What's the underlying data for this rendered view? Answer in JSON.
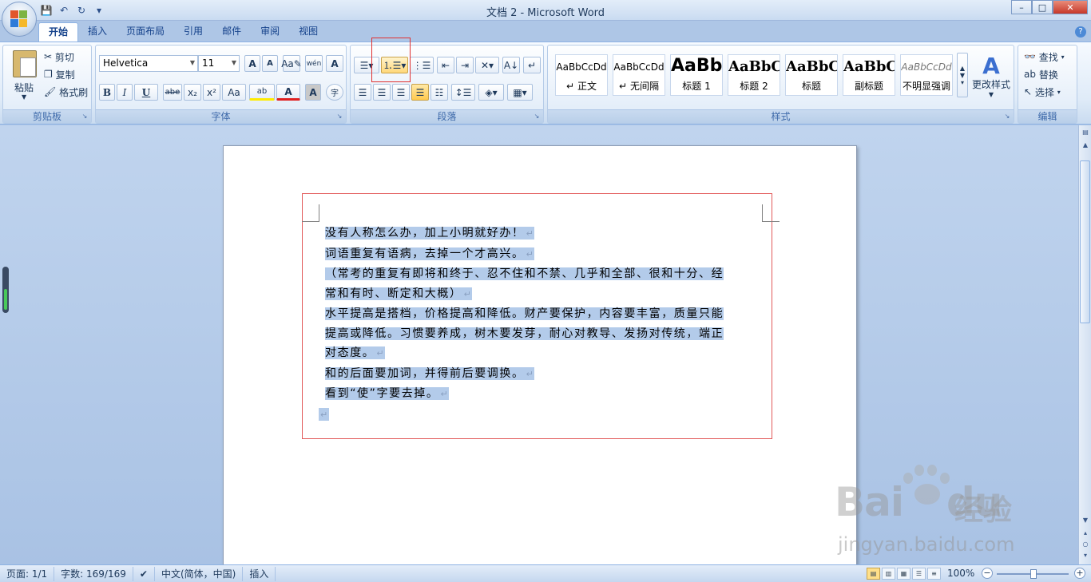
{
  "window": {
    "title": "文档 2 - Microsoft Word",
    "controls": {
      "minimize": "–",
      "maximize": "□",
      "close": "✕"
    }
  },
  "qat": {
    "save_icon": "💾",
    "undo_icon": "↶",
    "redo_icon": "↻",
    "more_icon": "▾"
  },
  "tabs": [
    {
      "label": "开始",
      "active": true
    },
    {
      "label": "插入"
    },
    {
      "label": "页面布局"
    },
    {
      "label": "引用"
    },
    {
      "label": "邮件"
    },
    {
      "label": "审阅"
    },
    {
      "label": "视图"
    }
  ],
  "ribbon": {
    "clipboard": {
      "label": "剪贴板",
      "paste": "粘贴",
      "cut": "剪切",
      "copy": "复制",
      "format_painter": "格式刷"
    },
    "font": {
      "label": "字体",
      "family": "Helvetica",
      "size": "11",
      "grow": "A",
      "shrink": "A",
      "bold": "B",
      "italic": "I",
      "underline": "U",
      "strike": "abe",
      "subscript": "x₂",
      "superscript": "x²",
      "case": "Aa",
      "highlight": "ab",
      "font_color": "A",
      "char_shade": "A",
      "enclose": "字",
      "phonetic": "wén",
      "border": "A"
    },
    "paragraph": {
      "label": "段落"
    },
    "styles": {
      "label": "样式",
      "items": [
        {
          "sample": "AaBbCcDd",
          "name": "正文",
          "mark": "↵"
        },
        {
          "sample": "AaBbCcDd",
          "name": "无间隔",
          "mark": "↵"
        },
        {
          "sample": "AaBb",
          "name": "标题 1"
        },
        {
          "sample": "AaBbC",
          "name": "标题 2"
        },
        {
          "sample": "AaBbC",
          "name": "标题"
        },
        {
          "sample": "AaBbC",
          "name": "副标题"
        },
        {
          "sample": "AaBbCcDd",
          "name": "不明显强调"
        }
      ],
      "change_styles": "更改样式"
    },
    "editing": {
      "label": "编辑",
      "find": "查找",
      "replace": "替换",
      "select": "选择"
    }
  },
  "document": {
    "lines": [
      "没有人称怎么办，加上小明就好办！",
      "词语重复有语病，去掉一个才高兴。",
      "（常考的重复有即将和终于、忍不住和不禁、几乎和全部、很和十分、经",
      "常和有时、断定和大概）",
      "水平提高是搭档，价格提高和降低。财产要保护，内容要丰富，质量只能",
      "提高或降低。习惯要养成，树木要发芽，耐心对教导、发扬对传统，端正",
      "对态度。",
      "和的后面要加词，并得前后要调换。",
      "看到“使”字要去掉。",
      ""
    ],
    "para_end_lines": [
      0,
      1,
      3,
      6,
      7,
      8,
      9
    ],
    "para_mark": "↵"
  },
  "statusbar": {
    "page": "页面: 1/1",
    "words": "字数: 169/169",
    "language": "中文(简体，中国)",
    "mode": "插入",
    "zoom": "100%"
  },
  "watermark": {
    "brand": "Bai",
    "brand2": "du",
    "cn": "经验",
    "url": "jingyan.baidu.com"
  },
  "colors": {
    "selection": "#b3cbea",
    "highlight_frame": "#e03030",
    "ribbon_text": "#15428b"
  }
}
